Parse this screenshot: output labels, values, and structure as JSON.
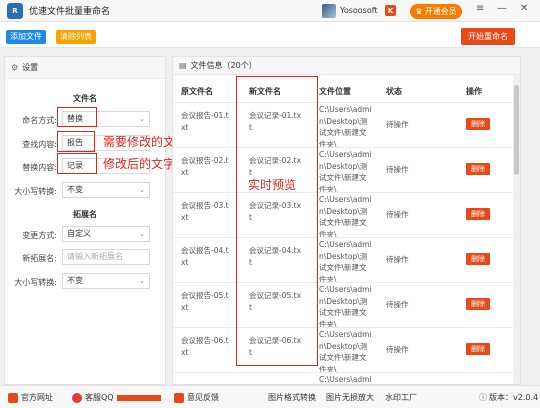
{
  "app": {
    "logo_text": "R",
    "title": "优速文件批量重命名"
  },
  "user": {
    "name": "Yosoosoft",
    "mark": "K",
    "vip_label": "开通会员"
  },
  "window_controls": {
    "menu": "≡",
    "minimize": "—",
    "close": "✕"
  },
  "toolbar": {
    "add_files": "添加文件",
    "clear_list": "清除列表",
    "start_rename": "开始重命名",
    "add_color": "#1e88e5",
    "clear_color": "#ffa000",
    "start_color": "#e64a19"
  },
  "settings": {
    "header": "设置",
    "filename_section": "文件名",
    "rename_mode_label": "命名方式:",
    "rename_mode_value": "替换",
    "find_label": "查找内容:",
    "find_value": "报告",
    "replace_label": "替换内容:",
    "replace_value": "记录",
    "case_label": "大小写转换:",
    "case_value": "不变",
    "ext_section": "拓展名",
    "change_mode_label": "变更方式:",
    "change_mode_value": "自定义",
    "new_ext_label": "新拓展名:",
    "new_ext_placeholder": "请输入新拓展名",
    "ext_case_label": "大小写转换:",
    "ext_case_value": "不变"
  },
  "annotations": {
    "need_modify": "需要修改的文字",
    "after_modify": "修改后的文字",
    "realtime_preview": "实时预览"
  },
  "files": {
    "header": "文件信息（20个）",
    "columns": [
      "原文件名",
      "新文件名",
      "文件位置",
      "状态",
      "操作"
    ],
    "rows": [
      {
        "orig": [
          "会议报告-01.t",
          "xt"
        ],
        "new": [
          "会议记录-01.tx",
          "t"
        ],
        "loc": [
          "C:\\Users\\admi",
          "n\\Desktop\\测",
          "试文件\\新建文",
          "件夹\\"
        ],
        "status": "待操作",
        "action": "删除"
      },
      {
        "orig": [
          "会议报告-02.t",
          "xt"
        ],
        "new": [
          "会议记录-02.tx",
          "t"
        ],
        "loc": [
          "C:\\Users\\admi",
          "n\\Desktop\\测",
          "试文件\\新建文",
          "件夹\\"
        ],
        "status": "待操作",
        "action": "删除"
      },
      {
        "orig": [
          "会议报告-03.t",
          "xt"
        ],
        "new": [
          "会议记录-03.tx",
          "t"
        ],
        "loc": [
          "C:\\Users\\admi",
          "n\\Desktop\\测",
          "试文件\\新建文",
          "件夹\\"
        ],
        "status": "待操作",
        "action": "删除"
      },
      {
        "orig": [
          "会议报告-04.t",
          "xt"
        ],
        "new": [
          "会议记录-04.tx",
          "t"
        ],
        "loc": [
          "C:\\Users\\admi",
          "n\\Desktop\\测",
          "试文件\\新建文",
          "件夹\\"
        ],
        "status": "待操作",
        "action": "删除"
      },
      {
        "orig": [
          "会议报告-05.t",
          "xt"
        ],
        "new": [
          "会议记录-05.tx",
          "t"
        ],
        "loc": [
          "C:\\Users\\admi",
          "n\\Desktop\\测",
          "试文件\\新建文",
          "件夹\\"
        ],
        "status": "待操作",
        "action": "删除"
      },
      {
        "orig": [
          "会议报告-06.t",
          "xt"
        ],
        "new": [
          "会议记录-06.tx",
          "t"
        ],
        "loc": [
          "C:\\Users\\admi",
          "n\\Desktop\\测",
          "试文件\\新建文",
          "件夹\\"
        ],
        "status": "待操作",
        "action": "删除"
      },
      {
        "orig": [
          "",
          ""
        ],
        "new": [
          "",
          ""
        ],
        "loc": [
          "C:\\Users\\admi",
          "",
          "",
          ""
        ],
        "status": "",
        "action": ""
      }
    ]
  },
  "footer": {
    "website": "官方网址",
    "support": "客服QQ",
    "qq_number": "",
    "feedback": "意见反馈",
    "tool1": "图片格式转换",
    "tool2": "图片无损放大",
    "tool3": "水印工厂",
    "version": "版本：v2.0.4"
  }
}
